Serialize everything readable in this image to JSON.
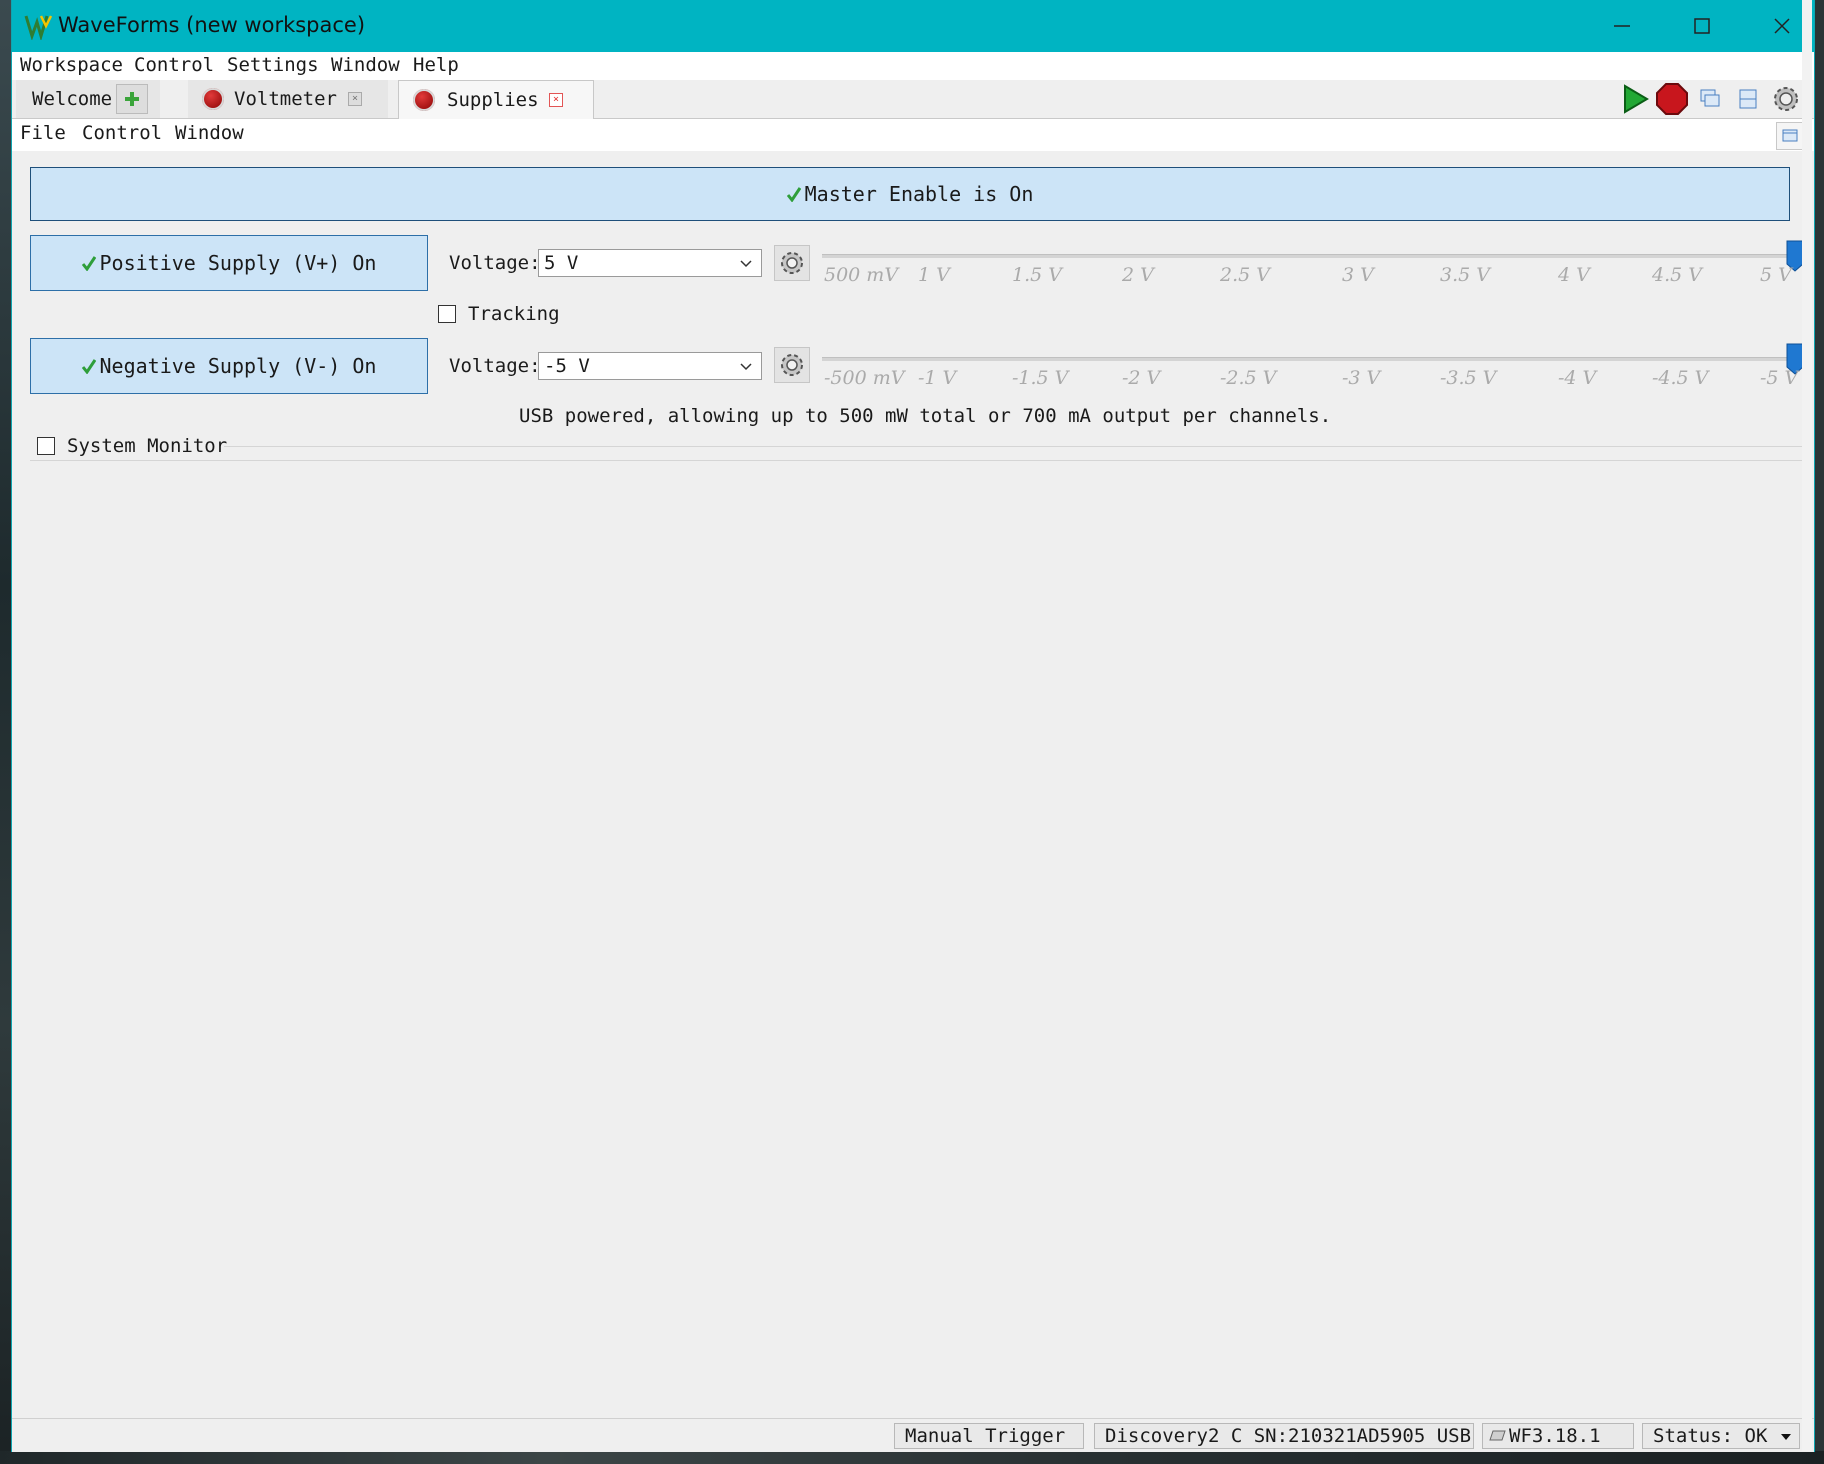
{
  "window": {
    "title": "WaveForms (new workspace)"
  },
  "menubar": {
    "items": [
      "Workspace",
      "Control",
      "Settings",
      "Window",
      "Help"
    ]
  },
  "tabs": {
    "welcome": "Welcome",
    "voltmeter": "Voltmeter",
    "supplies": "Supplies"
  },
  "submenu": {
    "items": [
      "File",
      "Control",
      "Window"
    ]
  },
  "supplies": {
    "master_enable": "Master Enable is On",
    "positive": {
      "button_label": "Positive Supply (V+) On",
      "voltage_label": "Voltage:",
      "voltage_value": "5 V",
      "slider_level": "5 V",
      "ticks": [
        "500 mV",
        "1 V",
        "1.5 V",
        "2 V",
        "2.5 V",
        "3 V",
        "3.5 V",
        "4 V",
        "4.5 V",
        "5 V"
      ]
    },
    "tracking_label": "Tracking",
    "tracking_checked": false,
    "negative": {
      "button_label": "Negative Supply (V-) On",
      "voltage_label": "Voltage:",
      "voltage_value": "-5 V",
      "slider_level": "-5 V",
      "ticks": [
        "-500 mV",
        "-1 V",
        "-1.5 V",
        "-2 V",
        "-2.5 V",
        "-3 V",
        "-3.5 V",
        "-4 V",
        "-4.5 V",
        "-5 V"
      ]
    },
    "usb_info": "USB powered, allowing up to 500 mW total or 700 mA output per channels.",
    "system_monitor_label": "System Monitor",
    "system_monitor_checked": false
  },
  "statusbar": {
    "manual_trigger": "Manual Trigger",
    "device": "Discovery2 C SN:210321AD5905 USB",
    "version": "WF3.18.1",
    "status": "Status: OK"
  },
  "colors": {
    "titlebar": "#00b4c2",
    "button_bg": "#cce4f7",
    "slider_thumb": "#1f78d1",
    "check_green": "#2e9e3a"
  }
}
